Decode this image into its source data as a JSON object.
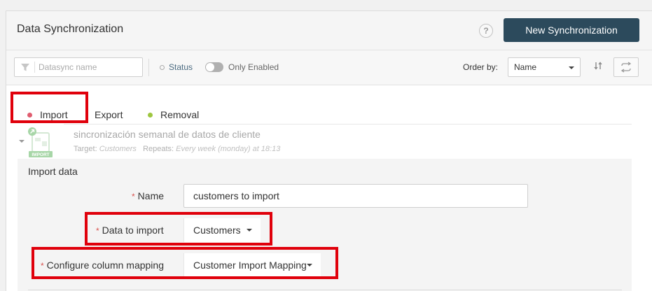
{
  "header": {
    "title": "Data Synchronization",
    "help_label": "?",
    "new_button_label": "New Synchronization"
  },
  "toolbar": {
    "search_placeholder": "Datasync name",
    "search_value": "",
    "status_label": "Status",
    "only_enabled_label": "Only Enabled",
    "only_enabled_on": false,
    "order_by_label": "Order by:",
    "order_by_value": "Name"
  },
  "tabs": [
    {
      "label": "Import",
      "dot_color": "#e05d6f",
      "active": true
    },
    {
      "label": "Export",
      "dot_color": "",
      "active": false
    },
    {
      "label": "Removal",
      "dot_color": "#9ec63f",
      "active": false
    }
  ],
  "item": {
    "icon_badge": "IMPORT",
    "title": "sincronización semanal de datos de cliente",
    "target_label": "Target:",
    "target_value": "Customers",
    "repeats_label": "Repeats:",
    "repeats_value": "Every week (monday) at 18:13"
  },
  "form": {
    "title": "Import data",
    "name_label": "Name",
    "name_value": "customers to import",
    "data_label": "Data to import",
    "data_value": "Customers",
    "mapping_label": "Configure column mapping",
    "mapping_value": "Customer Import Mapping",
    "required_marker": "*"
  },
  "colors": {
    "primary_button": "#2c4a5c",
    "highlight": "#e0000b",
    "import_dot": "#e05d6f",
    "removal_dot": "#9ec63f",
    "icon_green": "#5cb85c"
  }
}
